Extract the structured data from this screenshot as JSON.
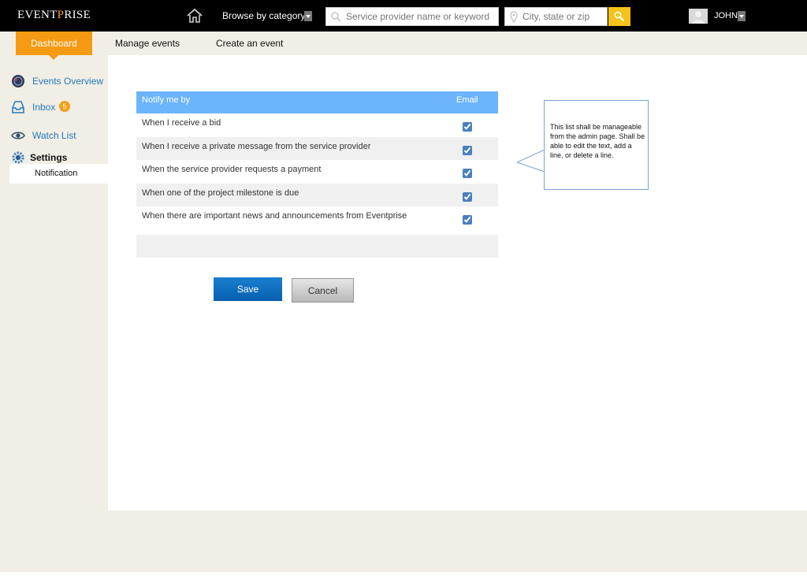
{
  "header": {
    "logo_a": "EVENT",
    "logo_b": "P",
    "logo_c": "RISE",
    "browse_label": "Browse by category",
    "search_placeholder": "Service provider name or keyword",
    "location_placeholder": "City, state or zip",
    "user_name": "JOHN"
  },
  "tabs": [
    {
      "label": "Dashboard",
      "active": true
    },
    {
      "label": "Manage events"
    },
    {
      "label": "Create an event"
    }
  ],
  "sidebar": {
    "items": [
      {
        "label": "Events Overview"
      },
      {
        "label": "Inbox",
        "badge": "5"
      },
      {
        "label": "Watch List"
      },
      {
        "label": "Settings"
      }
    ],
    "sub_item": "Notification"
  },
  "table": {
    "col_label": "Notify me by",
    "col_email": "Email",
    "rows": [
      {
        "label": "When I receive a bid",
        "checked": true
      },
      {
        "label": "When I receive a private message from the service provider",
        "checked": true
      },
      {
        "label": "When the service provider requests a payment",
        "checked": true
      },
      {
        "label": "When one of the project milestone is due",
        "checked": true
      },
      {
        "label": "When there are important news and announcements from Eventprise",
        "checked": true
      }
    ]
  },
  "buttons": {
    "save": "Save",
    "cancel": "Cancel"
  },
  "callout": "This list shall be manageable from the admin page. Shall be able to edit the text, add a line, or delete a line.",
  "colors": {
    "accent_orange": "#f59a12",
    "header_bg": "#000000",
    "table_header": "#6cb4fb",
    "save_button": "#0a68b8",
    "link_blue": "#2279bd"
  }
}
